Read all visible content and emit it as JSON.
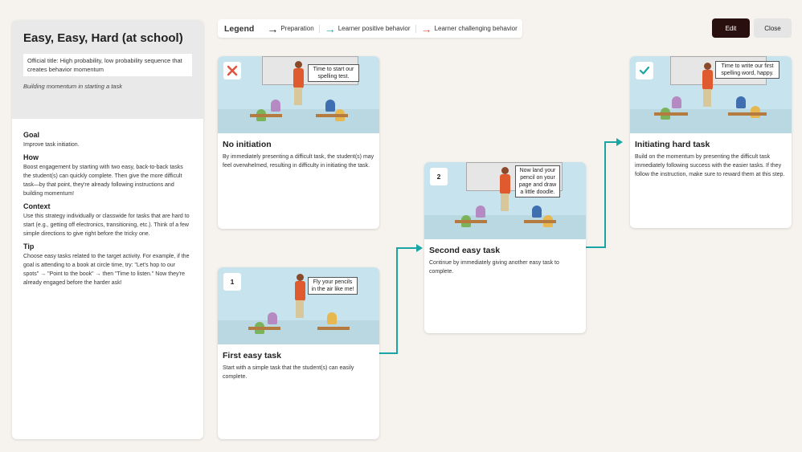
{
  "left_panel": {
    "title": "Easy, Easy, Hard (at school)",
    "official_title": "Official title: High probability, low probability sequence that creates behavior momentum",
    "subtitle": "Building momentum in starting a task",
    "sections": [
      {
        "heading": "Goal",
        "text": "Improve task initiation."
      },
      {
        "heading": "How",
        "text": "Boost engagement by starting with two easy, back-to-back tasks the student(s) can quickly complete. Then give the more difficult task—by that point, they're already following instructions and building momentum!"
      },
      {
        "heading": "Context",
        "text": "Use this strategy individually or classwide for tasks that are hard to start (e.g., getting off electronics, transitioning, etc.). Think of a few simple directions to give right before the tricky one."
      },
      {
        "heading": "Tip",
        "text": "Choose easy tasks related to the target activity. For example, if the goal is attending to a book at circle time, try: \"Let's hop to our spots\" → \"Point to the book\" → then \"Time to listen.\" Now they're already engaged before the harder ask!"
      }
    ]
  },
  "legend": {
    "title": "Legend",
    "items": [
      {
        "label": "Preparation",
        "color": "#222222",
        "arrow": "→"
      },
      {
        "label": "Learner positive behavior",
        "color": "#1aa5a5",
        "arrow": "→"
      },
      {
        "label": "Learner challenging behavior",
        "color": "#e0523a",
        "arrow": "→"
      }
    ]
  },
  "toolbar": {
    "edit_label": "Edit",
    "close_label": "Close"
  },
  "cards": {
    "no_initiation": {
      "badge_icon": "x-mark-icon",
      "bubble": "Time to start our spelling test.",
      "title": "No initiation",
      "text": "By immediately presenting a difficult task, the student(s) may feel overwhelmed, resulting in difficulty in initiating the task."
    },
    "first_easy": {
      "badge": "1",
      "bubble": "Fly your pencils in the air like me!",
      "title": "First easy task",
      "text": "Start with a simple task that the student(s) can easily complete."
    },
    "second_easy": {
      "badge": "2",
      "bubble": "Now land your pencil on your page and draw a little doodle.",
      "title": "Second easy task",
      "text": "Continue by immediately giving another easy task to complete."
    },
    "hard_task": {
      "badge_icon": "check-mark-icon",
      "bubble": "Time to write our first spelling word, happy.",
      "title": "Initiating hard task",
      "text": "Build on the momentum by presenting the difficult task immediately following success with the easier tasks. If they follow the instruction, make sure to reward them at this step."
    }
  },
  "colors": {
    "positive": "#1aa5a5",
    "challenging": "#e0523a",
    "edit_button": "#2a0f0f"
  }
}
